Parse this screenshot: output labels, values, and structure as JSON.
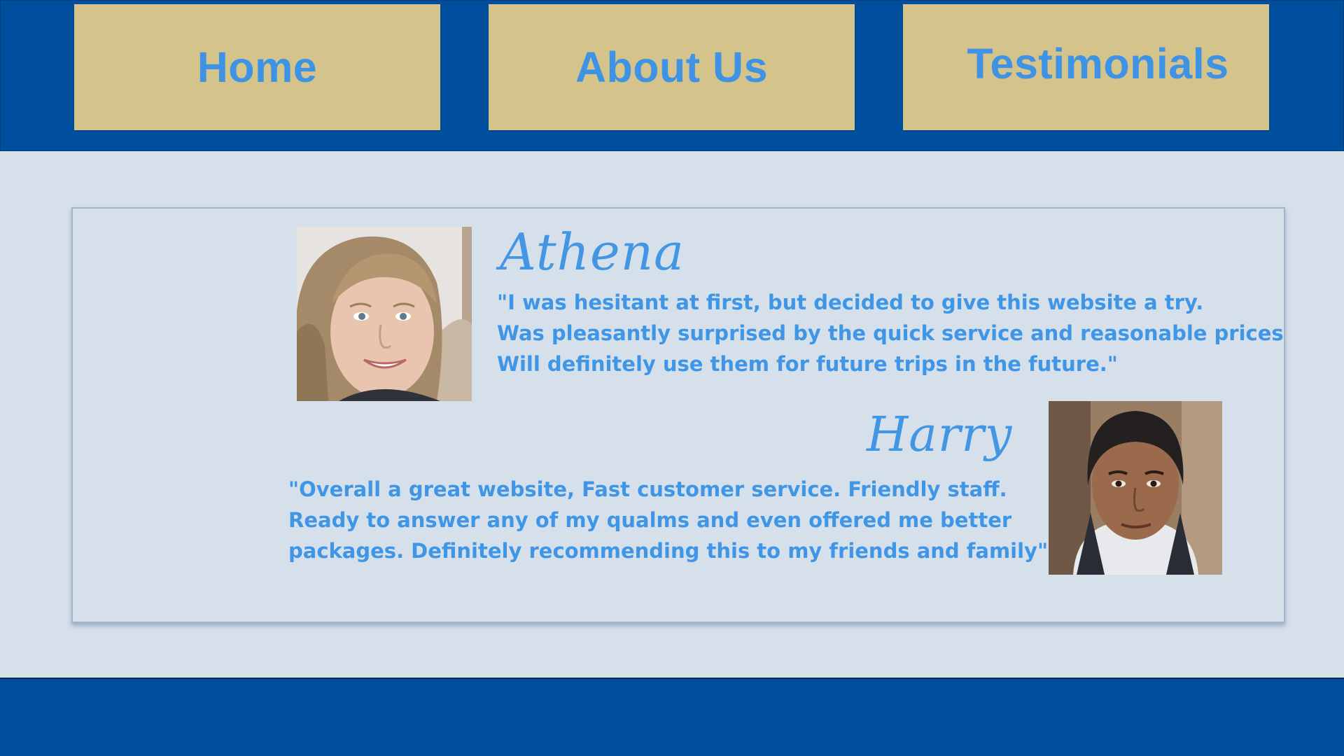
{
  "nav": {
    "items": [
      {
        "label": "Home"
      },
      {
        "label": "About Us"
      },
      {
        "label": "Testimonials"
      }
    ]
  },
  "testimonials": [
    {
      "name": "Athena",
      "photo": "portrait-of-smiling-woman",
      "quote_lines": [
        "\"I was hesitant at first, but decided to give this website a try.",
        "Was pleasantly surprised by the quick service and reasonable prices",
        "Will definitely use them for future trips in the future.\""
      ]
    },
    {
      "name": "Harry",
      "photo": "portrait-of-young-man",
      "quote_lines": [
        "\"Overall a great website, Fast customer service. Friendly staff.",
        "Ready to answer any of my qualms and even offered me better",
        "packages. Definitely recommending this to my friends and family\""
      ]
    }
  ],
  "colors": {
    "header_bg": "#004f9e",
    "nav_button_bg": "#d4c48c",
    "accent_text": "#3f93e5",
    "page_bg": "#d6e0ea"
  }
}
